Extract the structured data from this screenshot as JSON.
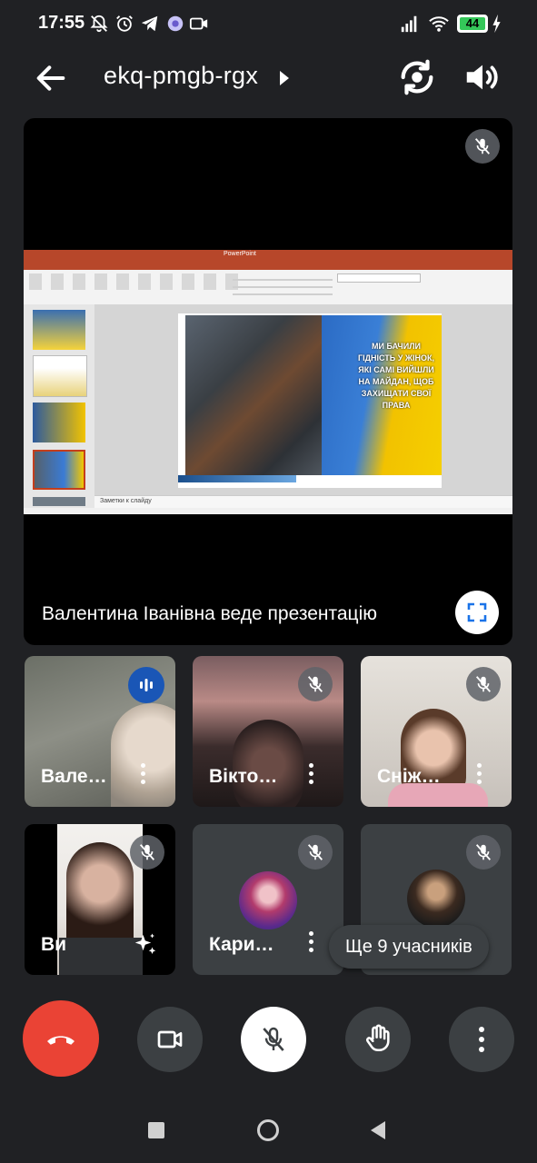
{
  "status_bar": {
    "time": "17:55",
    "battery": "44",
    "icons": [
      "bell-off-icon",
      "alarm-icon",
      "telegram-icon",
      "app-icon",
      "video-icon",
      "signal-icon",
      "wifi-icon",
      "battery-icon",
      "charging-icon"
    ]
  },
  "header": {
    "meeting_code": "ekq-pmgb-rgx"
  },
  "presentation": {
    "presenter_text": "Валентина Іванівна веде презентацію",
    "slide_text": "МИ БАЧИЛИ ГІДНІСТЬ У ЖІНОК, ЯКІ САМІ ВИЙШЛИ НА МАЙДАН, ЩОБ ЗАХИЩАТИ СВОЇ ПРАВА",
    "notes_placeholder": "Заметки к слайду",
    "app_title": "PowerPoint"
  },
  "participants": [
    {
      "name": "Вале…"
    },
    {
      "name": "Вікто…"
    },
    {
      "name": "Сніж…"
    },
    {
      "name": "Ви"
    },
    {
      "name": "Кари…"
    }
  ],
  "more_participants": "Ще 9 учасників",
  "colors": {
    "end_call": "#ea4335",
    "speaking": "#1a56b6",
    "tile_bg": "#3c4043",
    "accent_blue": "#1a73e8"
  }
}
